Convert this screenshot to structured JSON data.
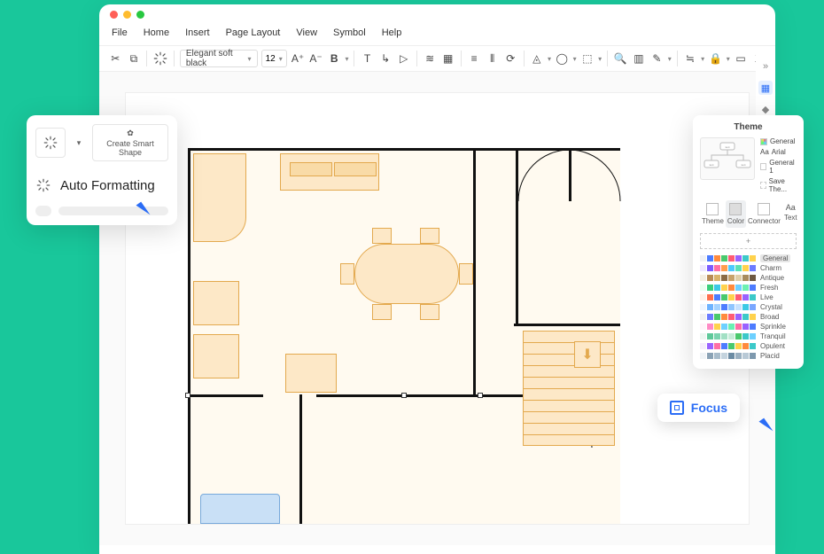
{
  "menu": {
    "items": [
      "File",
      "Home",
      "Insert",
      "Page Layout",
      "View",
      "Symbol",
      "Help"
    ]
  },
  "toolbar": {
    "font_name": "Elegant soft black",
    "font_size": "12"
  },
  "popover_left": {
    "create_smart_shape": "Create Smart\nShape",
    "auto_formatting": "Auto Formatting"
  },
  "sidebar_tabs": [
    "expand",
    "canvas",
    "shape",
    "layer",
    "page",
    "align",
    "ruler",
    "grid",
    "lock",
    "export"
  ],
  "theme_panel": {
    "title": "Theme",
    "opts": [
      "General",
      "Arial",
      "General 1",
      "Save The..."
    ],
    "tabs": [
      "Theme",
      "Color",
      "Connector",
      "Text"
    ],
    "active_tab_index": 1,
    "add": "+",
    "palettes": [
      {
        "name": "General",
        "colors": [
          "#f0f2f5",
          "#4d7cff",
          "#ff8a3d",
          "#49c96d",
          "#ff5c74",
          "#9a62ff",
          "#3cc9c9",
          "#ffd24d"
        ]
      },
      {
        "name": "Charm",
        "colors": [
          "#efe8ff",
          "#7a5cff",
          "#ff6fa5",
          "#ff9d4d",
          "#4dc9ff",
          "#5ce0b6",
          "#ffd24d",
          "#6d7cff"
        ]
      },
      {
        "name": "Antique",
        "colors": [
          "#f5efe2",
          "#b88b55",
          "#d9b36a",
          "#8a6b45",
          "#c7a26a",
          "#e0cfa8",
          "#a88c5e",
          "#6e5942"
        ]
      },
      {
        "name": "Fresh",
        "colors": [
          "#eafff2",
          "#39cf7b",
          "#3cc9e5",
          "#ffd24d",
          "#ff8a3d",
          "#6dd0ff",
          "#6bf0b2",
          "#4d7cff"
        ]
      },
      {
        "name": "Live",
        "colors": [
          "#fff2ea",
          "#ff6f4d",
          "#4d7cff",
          "#49c96d",
          "#ffd24d",
          "#ff5c74",
          "#9a62ff",
          "#3cc9c9"
        ]
      },
      {
        "name": "Crystal",
        "colors": [
          "#eef6ff",
          "#6db3ff",
          "#a5d3ff",
          "#4d7cff",
          "#8fc5ff",
          "#c7e1ff",
          "#3cc9e5",
          "#7aa7ff"
        ]
      },
      {
        "name": "Broad",
        "colors": [
          "#f2f2f2",
          "#6b7cff",
          "#49c96d",
          "#ff8a3d",
          "#ff5c74",
          "#9a62ff",
          "#3cc9c9",
          "#ffd24d"
        ]
      },
      {
        "name": "Sprinkle",
        "colors": [
          "#fff5fa",
          "#ff8ac5",
          "#ffd24d",
          "#6dd0ff",
          "#6bf0b2",
          "#ff6fa5",
          "#9a62ff",
          "#4d7cff"
        ]
      },
      {
        "name": "Tranquil",
        "colors": [
          "#eef7f2",
          "#5ec99a",
          "#7bd4b0",
          "#a2e0c4",
          "#c7ecd9",
          "#49c96d",
          "#3cc9c9",
          "#6dd0ff"
        ]
      },
      {
        "name": "Opulent",
        "colors": [
          "#f6eefc",
          "#9a62ff",
          "#ff6fa5",
          "#4d7cff",
          "#49c96d",
          "#ffd24d",
          "#ff8a3d",
          "#3cc9c9"
        ]
      },
      {
        "name": "Placid",
        "colors": [
          "#f0f4f7",
          "#8aa2b5",
          "#a8bccb",
          "#c4d3de",
          "#6b8ba3",
          "#9ab0c1",
          "#b8c9d6",
          "#7e99ae"
        ]
      }
    ],
    "selected_palette_index": 0
  },
  "focus_chip": {
    "label": "Focus"
  }
}
